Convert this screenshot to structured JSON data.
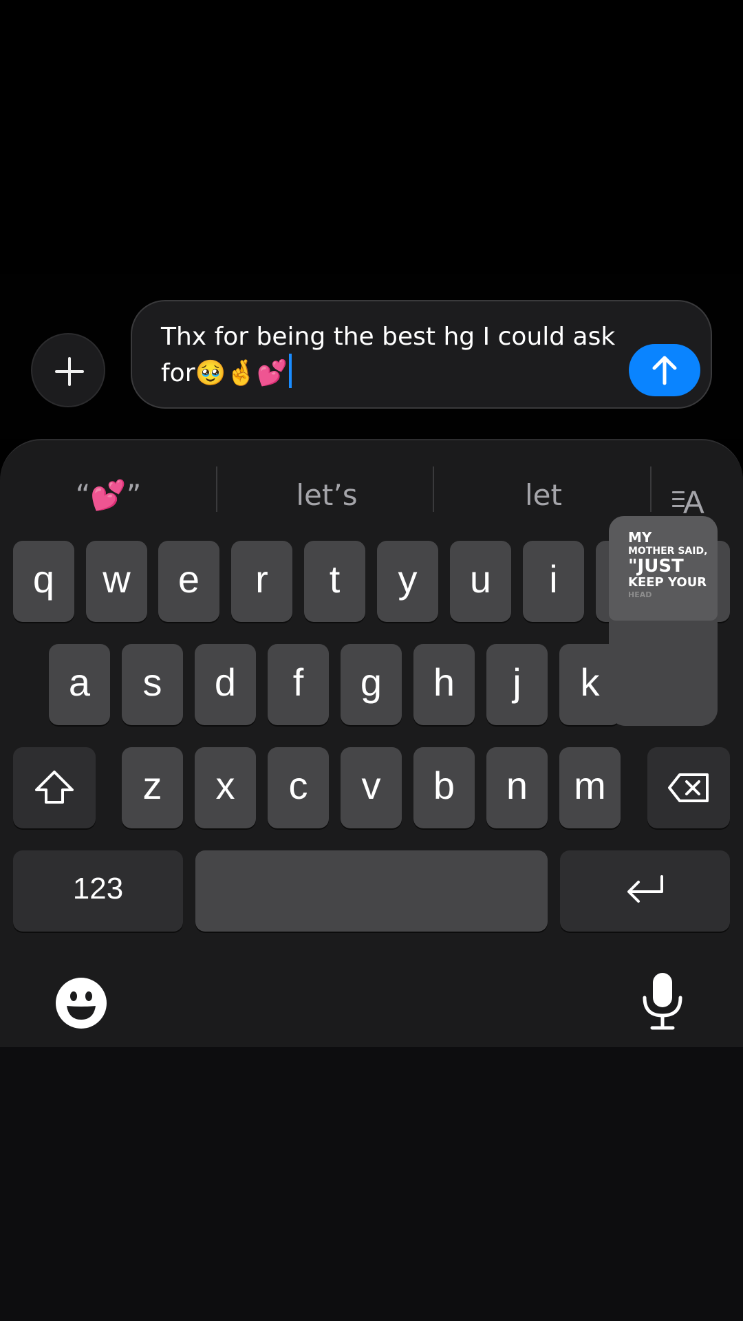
{
  "composer": {
    "message_text": "Thx for being the best hg I could ask for🥹🤞💕",
    "send_label": "Send"
  },
  "suggestions": {
    "first": "“💕”",
    "second": "let’s",
    "third": "let"
  },
  "keyboard": {
    "row1": [
      "q",
      "w",
      "e",
      "r",
      "t",
      "y",
      "u",
      "i"
    ],
    "row2": [
      "a",
      "s",
      "d",
      "f",
      "g",
      "h",
      "j",
      "k"
    ],
    "row3": [
      "z",
      "x",
      "c",
      "v",
      "b",
      "n",
      "m"
    ],
    "numbers_label": "123",
    "key_preview": {
      "line1": "MY",
      "line2": "MOTHER SAID,",
      "line3": "\"JUST",
      "line4": "KEEP YOUR",
      "line5": "HEAD"
    }
  },
  "colors": {
    "accent": "#0a84ff",
    "key": "#464648",
    "keyboard_bg": "#1b1b1c"
  }
}
